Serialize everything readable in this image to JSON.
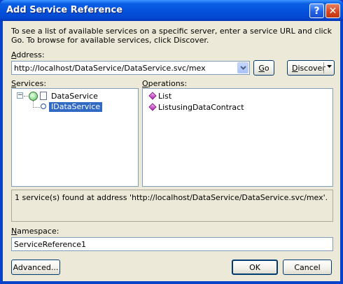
{
  "window": {
    "title": "Add Service Reference",
    "help_glyph": "?",
    "close_glyph": "✕"
  },
  "description": "To see a list of available services on a specific server, enter a service URL and click Go. To browse for available services, click Discover.",
  "address": {
    "label": "Address:",
    "value": "http://localhost/DataService/DataService.svc/mex",
    "go_label": "Go",
    "discover_label": "Discover"
  },
  "services": {
    "label": "Services:",
    "tree": {
      "root": "DataService",
      "root_expander": "⊟",
      "child": "IDataService"
    }
  },
  "operations": {
    "label": "Operations:",
    "items": [
      "List",
      "ListusingDataContract"
    ]
  },
  "status_text": "1 service(s) found at address 'http://localhost/DataService/DataService.svc/mex'.",
  "namespace": {
    "label": "Namespace:",
    "value": "ServiceReference1"
  },
  "buttons": {
    "advanced": "Advanced...",
    "ok": "OK",
    "cancel": "Cancel"
  },
  "colors": {
    "titlebar": "#0553dd",
    "dialog_bg": "#ece9d8",
    "selection": "#316ac5"
  }
}
